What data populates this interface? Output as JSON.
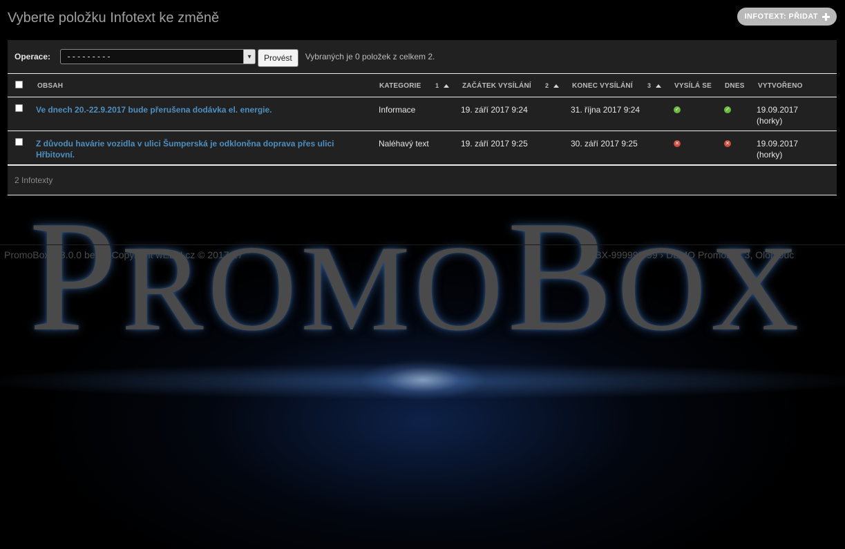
{
  "header": {
    "title": "Vyberte položku Infotext ke změně",
    "add_button_label": "INFOTEXT: PŘIDAT",
    "add_icon": "plus-icon"
  },
  "actions": {
    "label": "Operace:",
    "select_value": "---------",
    "run_label": "Provést",
    "counter_text": "Vybraných je 0 položek z celkem 2."
  },
  "table": {
    "headers": {
      "content": "OBSAH",
      "category": "KATEGORIE",
      "category_sort": "1",
      "start": "ZAČÁTEK VYSÍLÁNÍ",
      "start_sort": "2",
      "end": "KONEC VYSÍLÁNÍ",
      "end_sort": "3",
      "broadcasting": "VYSÍLÁ SE",
      "today": "DNES",
      "created": "VYTVOŘENO"
    },
    "rows": [
      {
        "content": "Ve dnech 20.-22.9.2017 bude přerušena dodávka el. energie.",
        "category": "Informace",
        "start": "19. září 2017 9:24",
        "end": "31. října 2017 9:24",
        "broadcasting": "check-icon",
        "today": "check-icon",
        "created_date": "19.09.2017",
        "created_by": "(horky)"
      },
      {
        "content": "Z důvodu havárie vozidla v ulici Šumperská je odkloněna doprava přes ulici Hřbitovní.",
        "category": "Naléhavý text",
        "start": "19. září 2017 9:25",
        "end": "30. září 2017 9:25",
        "broadcasting": "cross-icon",
        "today": "cross-icon",
        "created_date": "19.09.2017",
        "created_by": "(horky)"
      }
    ]
  },
  "paginator": {
    "text": "2 Infotexty"
  },
  "footer": {
    "left": "PromoBox v-3.0.0 beta - Copyright wEBH.cz © 2017-17",
    "right": "PBX-999999-99 › DEMO Promobox 3, Olomouc"
  },
  "background": {
    "logo_cap1": "P",
    "logo_rest1": "ROMO",
    "logo_cap2": "B",
    "logo_rest2": "OX"
  },
  "colors": {
    "link": "#4f8fc0",
    "ok": "#6abb3f",
    "error": "#d24a3d",
    "panel": "#212121"
  }
}
